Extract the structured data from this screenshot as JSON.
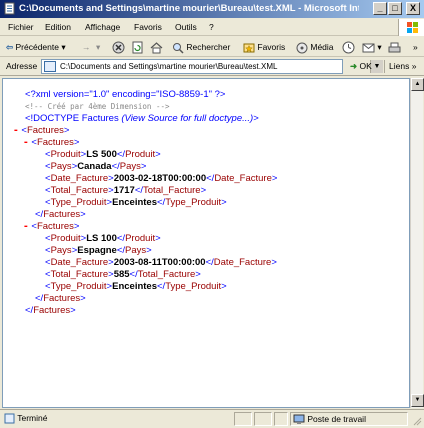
{
  "window": {
    "title": "C:\\Documents and Settings\\martine mourier\\Bureau\\test.XML - Microsoft Inte...",
    "btn_min": "_",
    "btn_max": "□",
    "btn_close": "X"
  },
  "menu": [
    "Fichier",
    "Edition",
    "Affichage",
    "Favoris",
    "Outils",
    "?"
  ],
  "toolbar": {
    "back": "Précédente",
    "forward": "→",
    "search": "Rechercher",
    "favorites": "Favoris",
    "media": "Média",
    "overflow": "»"
  },
  "address": {
    "label": "Adresse",
    "value": "C:\\Documents and Settings\\martine mourier\\Bureau\\test.XML",
    "go": "OK",
    "links": "Liens",
    "links_more": "»"
  },
  "xml": {
    "pi": "<?xml version=\"1.0\" encoding=\"ISO-8859-1\" ?>",
    "comment": "<!-- Créé par 4ème Dimension  -->",
    "doctype": "<!DOCTYPE Factures",
    "doctype_note": "(View Source for full doctype...)",
    "doctype_end": ">",
    "root_tag": "Factures",
    "groups": [
      {
        "tag": "Factures",
        "fields": [
          {
            "tag": "Produit",
            "value": "LS 500"
          },
          {
            "tag": "Pays",
            "value": "Canada"
          },
          {
            "tag": "Date_Facture",
            "value": "2003-02-18T00:00:00"
          },
          {
            "tag": "Total_Facture",
            "value": "1717"
          },
          {
            "tag": "Type_Produit",
            "value": "Enceintes"
          }
        ]
      },
      {
        "tag": "Factures",
        "fields": [
          {
            "tag": "Produit",
            "value": "LS 100"
          },
          {
            "tag": "Pays",
            "value": "Espagne"
          },
          {
            "tag": "Date_Facture",
            "value": "2003-08-11T00:00:00"
          },
          {
            "tag": "Total_Facture",
            "value": "585"
          },
          {
            "tag": "Type_Produit",
            "value": "Enceintes"
          }
        ]
      }
    ],
    "minus": "-"
  },
  "status": {
    "text": "Terminé",
    "zone": "Poste de travail"
  }
}
